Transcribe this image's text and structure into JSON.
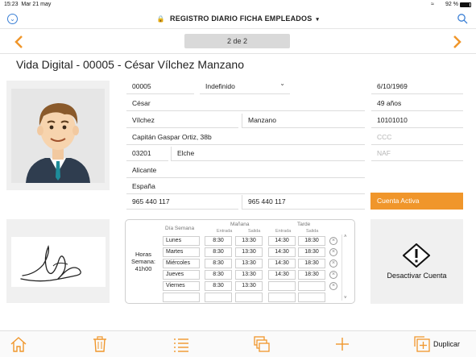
{
  "status_bar": {
    "time": "15:23",
    "date": "Mar 21 may",
    "battery": "92 %"
  },
  "header": {
    "title": "REGISTRO DIARIO FICHA EMPLEADOS",
    "caret": "▾"
  },
  "pager": {
    "count": "2  de  2"
  },
  "page_title": "Vida Digital - 00005 - César Vílchez Manzano",
  "employee": {
    "code": "00005",
    "contract": "Indefinido",
    "birth_date": "6/10/1969",
    "first_name": "César",
    "age": "49 años",
    "surname1": "Vílchez",
    "surname2": "Manzano",
    "id_number": "10101010",
    "address": "Capitán Gaspar Ortiz, 38b",
    "ccc_placeholder": "CCC",
    "postal_code": "03201",
    "city": "Elche",
    "naf_placeholder": "NAF",
    "province": "Alicante",
    "country": "España",
    "phone1": "965 440 117",
    "phone2": "965 440 117",
    "status_button": "Cuenta Activa"
  },
  "schedule": {
    "day_header": "Día Semana",
    "morning": "Mañana",
    "afternoon": "Tarde",
    "entrada": "Entrada",
    "salida": "Salida",
    "hours_label": "Horas Semana:",
    "hours_value": "41h00",
    "rows": [
      {
        "day": "Lunes",
        "m_in": "8:30",
        "m_out": "13:30",
        "t_in": "14:30",
        "t_out": "18:30"
      },
      {
        "day": "Martes",
        "m_in": "8:30",
        "m_out": "13:30",
        "t_in": "14:30",
        "t_out": "18:30"
      },
      {
        "day": "Miércoles",
        "m_in": "8:30",
        "m_out": "13:30",
        "t_in": "14:30",
        "t_out": "18:30"
      },
      {
        "day": "Jueves",
        "m_in": "8:30",
        "m_out": "13:30",
        "t_in": "14:30",
        "t_out": "18:30"
      },
      {
        "day": "Viernes",
        "m_in": "8:30",
        "m_out": "13:30",
        "t_in": "",
        "t_out": ""
      },
      {
        "day": "",
        "m_in": "",
        "m_out": "",
        "t_in": "",
        "t_out": ""
      }
    ]
  },
  "deactivate": {
    "label": "Desactivar Cuenta"
  },
  "toolbar": {
    "duplicate_label": "Duplicar"
  },
  "colors": {
    "accent": "#f0962b",
    "link_blue": "#3a7fd5"
  }
}
